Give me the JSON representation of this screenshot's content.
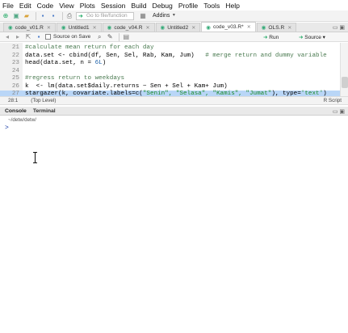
{
  "menu": [
    "File",
    "Edit",
    "Code",
    "View",
    "Plots",
    "Session",
    "Build",
    "Debug",
    "Profile",
    "Tools",
    "Help"
  ],
  "toolbar": {
    "goto_placeholder": "Go to file/function",
    "addins": "Addins"
  },
  "tabs": [
    {
      "label": "code_v01.R",
      "active": false
    },
    {
      "label": "Untitled1",
      "active": false
    },
    {
      "label": "code_v04.R",
      "active": false
    },
    {
      "label": "Untitled2",
      "active": false
    },
    {
      "label": "code_v03.R*",
      "active": true
    },
    {
      "label": "OLS.R",
      "active": false
    }
  ],
  "editor_toolbar": {
    "source_on_save": "Source on Save",
    "run": "Run",
    "source": "Source"
  },
  "code_lines": [
    {
      "num": "21",
      "parts": [
        {
          "t": "#calculate mean return for each day",
          "c": "cm"
        }
      ]
    },
    {
      "num": "22",
      "parts": [
        {
          "t": "data.set <- cbind(df, Sen, Sel, Rab, Kam, Jum)   ",
          "c": ""
        },
        {
          "t": "# merge return and dummy variable",
          "c": "cm"
        }
      ]
    },
    {
      "num": "23",
      "parts": [
        {
          "t": "head(data.set, n = ",
          "c": ""
        },
        {
          "t": "6L",
          "c": "num"
        },
        {
          "t": ")",
          "c": ""
        }
      ]
    },
    {
      "num": "24",
      "parts": [
        {
          "t": "",
          "c": ""
        }
      ]
    },
    {
      "num": "25",
      "parts": [
        {
          "t": "#regress return to weekdays",
          "c": "cm"
        }
      ]
    },
    {
      "num": "26",
      "parts": [
        {
          "t": "k  <- lm(data.set$daily.returns ~ Sen + Sel + Kam+ Jum)",
          "c": ""
        }
      ]
    },
    {
      "num": "27",
      "parts": [
        {
          "t": "stargazer(k, covariate.labels=c(",
          "c": ""
        },
        {
          "t": "\"Senin\", \"Selasa\", \"Kamis\", \"Jumat\"",
          "c": "str"
        },
        {
          "t": "), type=",
          "c": ""
        },
        {
          "t": "'text'",
          "c": "str"
        },
        {
          "t": ")",
          "c": ""
        }
      ],
      "selected": true
    }
  ],
  "status": {
    "position": "28:1",
    "level": "(Top Level)",
    "mode": "R Script"
  },
  "console": {
    "tab_console": "Console",
    "tab_terminal": "Terminal",
    "path": "~/detw/detw/",
    "prompt": ">"
  },
  "colors": {
    "comment": "#4a7a50",
    "string": "#1a8a2a",
    "number": "#1b5fa8",
    "selection": "#b9d6f7"
  }
}
